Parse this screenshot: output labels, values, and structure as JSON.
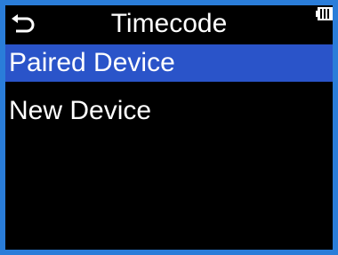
{
  "header": {
    "title": "Timecode",
    "back_icon": "return-arrow-icon",
    "battery_icon": "battery-icon",
    "battery_level": 0.75
  },
  "menu": {
    "items": [
      {
        "label": "Paired Device",
        "selected": true
      },
      {
        "label": "New Device",
        "selected": false
      }
    ]
  },
  "colors": {
    "frame": "#2a7dd9",
    "screen_background": "#000000",
    "selection": "#2a54c9",
    "text": "#ffffff"
  }
}
